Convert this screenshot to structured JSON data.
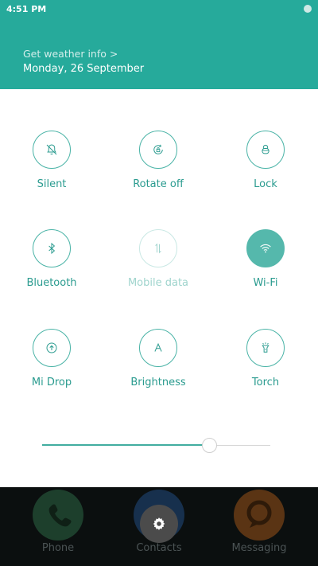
{
  "status_bar": {
    "time": "4:51 PM"
  },
  "header": {
    "weather_link": "Get weather info >",
    "date": "Monday, 26 September",
    "accent_color": "#26aa9b"
  },
  "toggles": [
    {
      "label": "Silent",
      "icon": "bell-off-icon",
      "state": "off"
    },
    {
      "label": "Rotate off",
      "icon": "rotate-lock-icon",
      "state": "off"
    },
    {
      "label": "Lock",
      "icon": "lock-icon",
      "state": "off"
    },
    {
      "label": "Bluetooth",
      "icon": "bluetooth-icon",
      "state": "off"
    },
    {
      "label": "Mobile data",
      "icon": "mobile-data-icon",
      "state": "disabled"
    },
    {
      "label": "Wi-Fi",
      "icon": "wifi-icon",
      "state": "on"
    },
    {
      "label": "Mi Drop",
      "icon": "upload-icon",
      "state": "off"
    },
    {
      "label": "Brightness",
      "icon": "brightness-a-icon",
      "state": "off"
    },
    {
      "label": "Torch",
      "icon": "torch-icon",
      "state": "off"
    }
  ],
  "brightness_slider": {
    "value_percent": 73
  },
  "dock": [
    {
      "label": "Phone",
      "icon": "phone-icon",
      "color": "#1d6b3c"
    },
    {
      "label": "Contacts",
      "icon": "contacts-icon",
      "color": "#1c4f86"
    },
    {
      "label": "Messaging",
      "icon": "messaging-icon",
      "color": "#b8601d"
    }
  ],
  "settings_button": {
    "icon": "gear-icon"
  }
}
